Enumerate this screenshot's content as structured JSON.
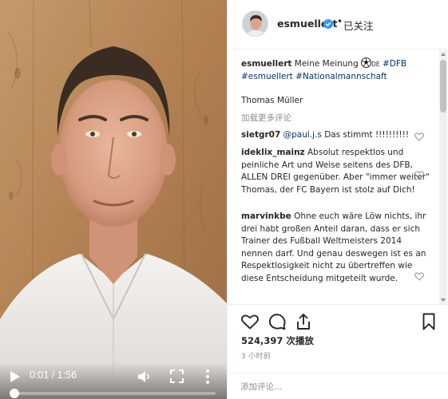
{
  "video": {
    "time_display": "0:01 / 1:56",
    "progress_fraction": 0.02,
    "play_icon": "play-icon",
    "volume_icon": "volume-icon",
    "fullscreen_icon": "fullscreen-icon",
    "more_icon": "more-vertical-icon"
  },
  "header": {
    "username": "esmuellert",
    "dot": "•",
    "follow_status": "已关注",
    "verified_icon": "verified-badge-icon",
    "verified_color": "#3897f0"
  },
  "caption": {
    "username": "esmuellert",
    "text": "Meine Meinung ",
    "flag": "DE",
    "hashtag_dfb": "#DFB",
    "hashtag_user": "#esmuellert",
    "hashtag_nm": "#Nationalmannschaft",
    "signature": "Thomas Müller"
  },
  "load_more": "加载更多评论",
  "comments": [
    {
      "username": "sietgr07",
      "mention": "@paul.j.s",
      "text": " Das stimmt !!!!!!!!!!"
    },
    {
      "username": "ideklix_mainz",
      "text": "Absolut respektlos und peinliche Art und Weise seitens des DFB, ALLEN DREI gegenüber. Aber \"immer weiter\" Thomas, der FC Bayern ist stolz auf Dich!"
    },
    {
      "username": "marvinkbe",
      "text": "Ohne euch wäre Löw nichts, ihr drei habt großen Anteil daran, dass er sich Trainer des Fußball Weltmeisters 2014 nennen darf. Und genau deswegen ist es an Respektlosigkeit nicht zu übertreffen wie diese Entscheidung mitgeteilt wurde."
    }
  ],
  "actions": {
    "like_icon": "heart-icon",
    "comment_icon": "comment-bubble-icon",
    "share_icon": "share-icon",
    "save_icon": "bookmark-icon"
  },
  "views": "524,397 次播放",
  "time_ago": "3 小时前",
  "comment_input": {
    "placeholder": "添加评论..."
  },
  "colors": {
    "link": "#003569",
    "muted": "#8e8e8e",
    "border": "#efefef",
    "text": "#262626"
  }
}
